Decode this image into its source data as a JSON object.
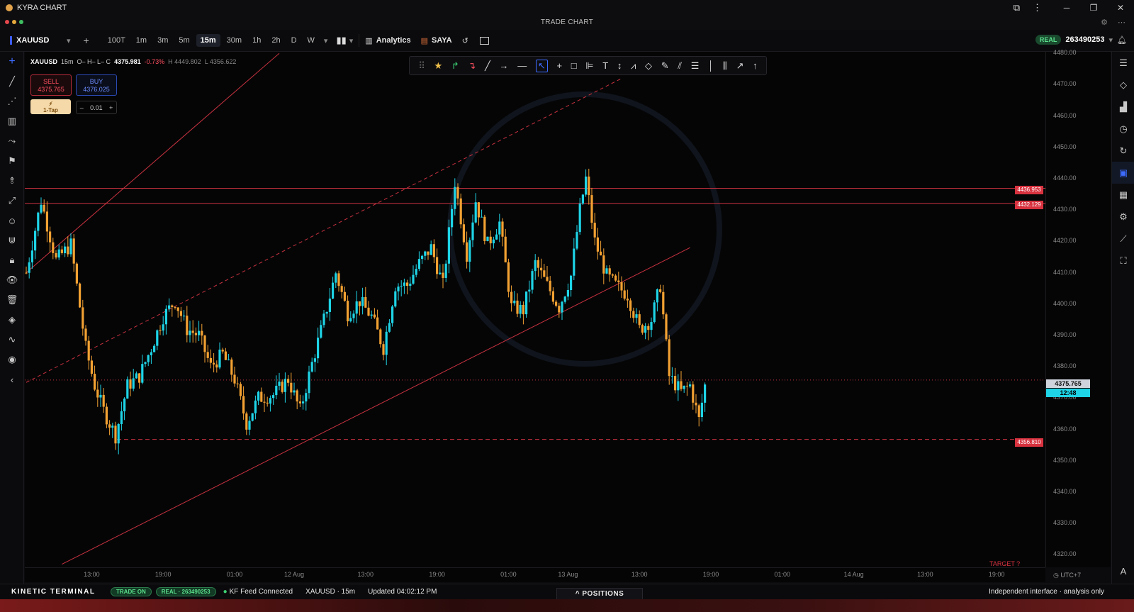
{
  "app": {
    "name": "KYRA CHART",
    "subtitle": "TRADE CHART"
  },
  "window": {
    "icons": [
      "restore-icon",
      "menu-icon",
      "minimize-icon",
      "maximize-icon",
      "close-icon"
    ],
    "minimize": "─",
    "maximize": "❐",
    "close": "✕"
  },
  "toolbar": {
    "symbol": "XAUUSD",
    "timeframes": [
      "100T",
      "1m",
      "3m",
      "5m",
      "15m",
      "30m",
      "1h",
      "2h",
      "D",
      "W"
    ],
    "active_timeframe": "15m",
    "analytics_label": "Analytics",
    "saya_label": "SAYA",
    "account_badge": "REAL",
    "account_number": "263490253"
  },
  "infobar": {
    "symbol": "XAUUSD",
    "tf": "15m",
    "ohlc": "O– H– L– C",
    "close": "4375.981",
    "change": "-0.73%",
    "high": "H 4449.802",
    "low": "L 4356.622"
  },
  "trade": {
    "sell_label": "SELL",
    "sell_price": "4375.765",
    "buy_label": "BUY",
    "buy_price": "4376.025",
    "onetap_label": "1-Tap",
    "lot_minus": "–",
    "lot_value": "0.01",
    "lot_plus": "+"
  },
  "price_labels": {
    "upper": "4436.953",
    "lower": "4432.129",
    "support": "4356.810"
  },
  "current_price": {
    "price": "4375.765",
    "timer": "12:48"
  },
  "target_label": "TARGET ?",
  "timezone": "UTC+7",
  "status": {
    "brand": "KINETIC TERMINAL",
    "trade_on": "TRADE ON",
    "real_pill": "REAL · 263490253",
    "feed": "KF Feed Connected",
    "symbol_tf": "XAUUSD · 15m",
    "updated": "Updated 04:02:12 PM",
    "positions": "^ POSITIONS",
    "disclaimer": "Independent interface · analysis only"
  },
  "colors": {
    "bull": "#1ed4e6",
    "bear": "#f2a132",
    "trendline": "#c8323f",
    "accent": "#3d6bff"
  },
  "chart_data": {
    "type": "candlestick",
    "symbol": "XAUUSD",
    "timeframe": "15m",
    "y_ticks": [
      4480,
      4470,
      4460,
      4450,
      4440,
      4430,
      4420,
      4410,
      4400,
      4390,
      4380,
      4370,
      4360,
      4350,
      4340,
      4330,
      4320
    ],
    "ylim": [
      4316,
      4480.5
    ],
    "x_ticks": [
      {
        "label": "13:00",
        "i": 22
      },
      {
        "label": "19:00",
        "i": 46
      },
      {
        "label": "01:00",
        "i": 70
      },
      {
        "label": "12 Aug",
        "i": 90
      },
      {
        "label": "13:00",
        "i": 114
      },
      {
        "label": "19:00",
        "i": 138
      },
      {
        "label": "01:00",
        "i": 162
      },
      {
        "label": "13 Aug",
        "i": 182
      },
      {
        "label": "13:00",
        "i": 206
      },
      {
        "label": "19:00",
        "i": 230
      },
      {
        "label": "01:00",
        "i": 254
      },
      {
        "label": "14 Aug",
        "i": 278
      },
      {
        "label": "13:00",
        "i": 302
      },
      {
        "label": "19:00",
        "i": 326
      }
    ],
    "key_points": [
      [
        0,
        4410
      ],
      [
        5,
        4433
      ],
      [
        10,
        4414
      ],
      [
        15,
        4419
      ],
      [
        20,
        4386
      ],
      [
        23,
        4374
      ],
      [
        26,
        4366
      ],
      [
        30,
        4358
      ],
      [
        34,
        4374
      ],
      [
        38,
        4377
      ],
      [
        42,
        4386
      ],
      [
        46,
        4396
      ],
      [
        50,
        4401
      ],
      [
        54,
        4392
      ],
      [
        58,
        4390
      ],
      [
        62,
        4380
      ],
      [
        66,
        4384
      ],
      [
        70,
        4376
      ],
      [
        74,
        4362
      ],
      [
        78,
        4370
      ],
      [
        83,
        4371
      ],
      [
        88,
        4376
      ],
      [
        92,
        4366
      ],
      [
        96,
        4381
      ],
      [
        100,
        4395
      ],
      [
        104,
        4410
      ],
      [
        108,
        4397
      ],
      [
        112,
        4401
      ],
      [
        116,
        4396
      ],
      [
        120,
        4386
      ],
      [
        124,
        4406
      ],
      [
        128,
        4406
      ],
      [
        132,
        4413
      ],
      [
        136,
        4418
      ],
      [
        140,
        4406
      ],
      [
        144,
        4439
      ],
      [
        148,
        4416
      ],
      [
        151,
        4433
      ],
      [
        155,
        4419
      ],
      [
        159,
        4426
      ],
      [
        163,
        4399
      ],
      [
        167,
        4398
      ],
      [
        171,
        4413
      ],
      [
        175,
        4406
      ],
      [
        179,
        4399
      ],
      [
        183,
        4409
      ],
      [
        186,
        4430
      ],
      [
        188,
        4440
      ],
      [
        191,
        4420
      ],
      [
        195,
        4409
      ],
      [
        198,
        4406
      ],
      [
        202,
        4403
      ],
      [
        206,
        4392
      ],
      [
        210,
        4395
      ],
      [
        213,
        4406
      ],
      [
        216,
        4377
      ],
      [
        220,
        4372
      ],
      [
        223,
        4374
      ],
      [
        226,
        4363
      ],
      [
        228,
        4374
      ]
    ],
    "candle_count": 229,
    "current": 4375.765,
    "horizontal_levels": [
      4436.953,
      4432.129
    ],
    "support_level": 4356.81,
    "channel_lines": [
      {
        "style": "solid",
        "i1": 0,
        "p1": 4410,
        "i2": 85,
        "p2": 4480
      },
      {
        "style": "dashed",
        "i1": 0,
        "p1": 4375,
        "i2": 200,
        "p2": 4472
      },
      {
        "style": "solid",
        "i1": 12,
        "p1": 4317,
        "i2": 223,
        "p2": 4418
      }
    ]
  }
}
